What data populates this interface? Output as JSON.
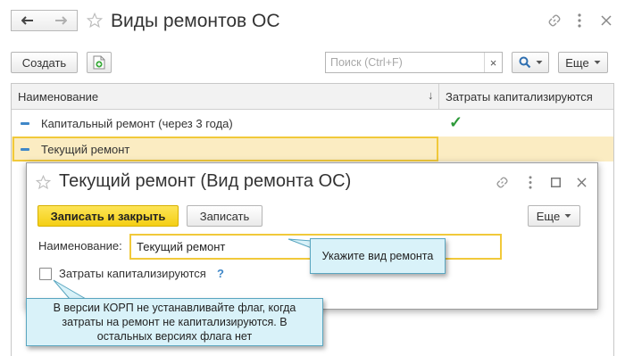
{
  "window": {
    "title": "Виды ремонтов ОС",
    "toolbar": {
      "create_label": "Создать",
      "search_placeholder": "Поиск (Ctrl+F)",
      "search_clear": "×",
      "more_label": "Еще"
    },
    "table": {
      "columns": [
        "Наименование",
        "Затраты капитализируются"
      ],
      "rows": [
        {
          "name": "Капитальный ремонт (через 3 года)",
          "capitalized": "✓"
        },
        {
          "name": "Текущий ремонт",
          "capitalized": ""
        }
      ]
    }
  },
  "dialog": {
    "title": "Текущий ремонт (Вид ремонта ОС)",
    "save_close_label": "Записать и закрыть",
    "save_label": "Записать",
    "more_label": "Еще",
    "name_label": "Наименование:",
    "name_value": "Текущий ремонт",
    "checkbox_label": "Затраты капитализируются",
    "checkbox_checked": false,
    "help_mark": "?"
  },
  "callouts": {
    "name_hint": "Укажите вид ремонта",
    "checkbox_hint_line1": "В версии КОРП не устанавливайте флаг, когда",
    "checkbox_hint_line2": "затраты на ремонт не капитализируются. В",
    "checkbox_hint_line3": "остальных версиях флага нет"
  },
  "colors": {
    "accent_yellow": "#f7d21d",
    "selected_row": "#fbecc2",
    "checkmark": "#2e9a3a",
    "link_blue": "#3f87c8",
    "callout_bg": "#d9f2f9"
  }
}
